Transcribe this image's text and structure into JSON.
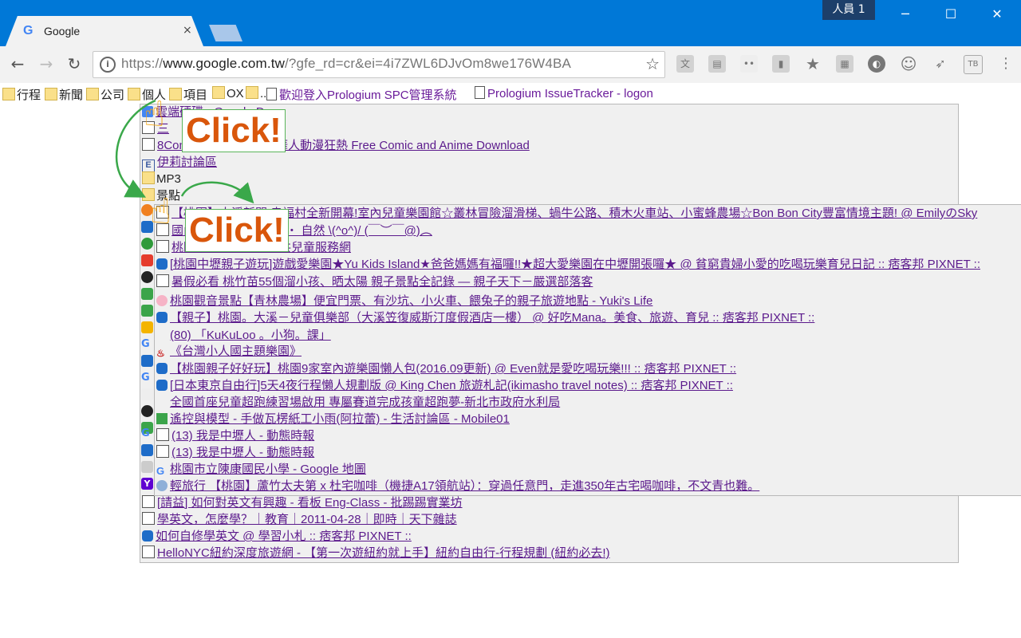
{
  "window": {
    "profile_label": "人員 1",
    "minimize": "─",
    "maximize": "☐",
    "close": "✕"
  },
  "tab": {
    "favicon": "G",
    "title": "Google",
    "close": "×"
  },
  "toolbar": {
    "back": "←",
    "forward": "→",
    "reload": "↻",
    "url_prefix": "https://",
    "url_host": "www.google.com.tw",
    "url_rest": "/?gfe_rd=cr&ei=4i7ZWL6DJvOm8we176W4BA",
    "star": "☆",
    "extensions": [
      "translate-icon",
      "clipboard-icon",
      "dots-icon",
      "bookmark-icon",
      "star-icon",
      "chat-icon",
      "moon-icon",
      "smiley-icon",
      "rocket-icon",
      "tb-icon",
      "menu-icon"
    ]
  },
  "bookmarks": {
    "items": [
      "行程",
      "新聞",
      "公司",
      "個人",
      "項目",
      "OX",
      ".."
    ],
    "link1": "歡迎登入Prologium SPC管理系統",
    "link2": "Prologium IssueTracker - logon"
  },
  "folder_menu": {
    "items": [
      {
        "label": "雲端硬碟 - Google Docs",
        "type": "link"
      },
      {
        "label": "三",
        "type": "link"
      },
      {
        "label": "8Comic 無限動漫 全球華人動漫狂熱 Free Comic and Anime Download",
        "type": "link"
      },
      {
        "label": "伊莉討論區",
        "type": "link"
      },
      {
        "label": "MP3",
        "type": "folder"
      },
      {
        "label": "景點",
        "type": "folder"
      }
    ]
  },
  "lower_items": [
    "[請益] 如何對英文有興趣 - 看板 Eng-Class - 批踢踢實業坊",
    "學英文，怎麼學？｜教育｜2011-04-28｜即時｜天下雜誌",
    "如何自修學英文 @ 學習小札 :: 痞客邦 PIXNET ::",
    "HelloNYC紐約深度旅遊網 - 【第一次遊紐約就上手】紐約自由行-行程規劃 (紐約必去!)"
  ],
  "submenu": {
    "items": [
      "【桃園】大溪新開 幸福村全新開幕!室內兒童樂園館☆叢林冒險溜滑梯、蝸牛公路、積木火車站、小蜜蜂農場☆Bon Bon City豐富情境主題! @ EmilyのSky",
      "國內親子旅遊 小旅行 ‧ 自然 \\(^o^)/ (￣︶￣@)︵",
      "桃園親子館大竹溪公共兒童服務網",
      "[桃園中壢親子遊玩]遊戲愛樂園★Yu Kids Island★爸爸媽媽有福囉!!★超大愛樂園在中壢開張囉★ @ 貧窮貴婦小愛的吃喝玩樂育兒日記 :: 痞客邦 PIXNET ::",
      "暑假必看 桃竹苗55個溜小孩、晒太陽 親子景點全記錄 — 親子天下－嚴選部落客",
      "桃園觀音景點【青林農場】便宜門票、有沙坑、小火車、餵兔子的親子旅遊地點 - Yuki's Life",
      "【親子】桃園。大溪－兒童俱樂部（大溪笠復威斯汀度假酒店一樓） @ 好吃Mana。美食、旅遊、育兒 :: 痞客邦 PIXNET ::",
      "(80) 「KuKuLoo 。小狗。課」",
      "《台灣小人國主題樂園》",
      "【桃園親子好好玩】桃園9家室內遊樂園懶人包(2016.09更新) @ Even就是愛吃喝玩樂!!! :: 痞客邦 PIXNET ::",
      "[日本東京自由行]5天4夜行程懶人規劃版 @ King Chen 旅遊札記(ikimasho travel notes) :: 痞客邦 PIXNET ::",
      "全國首座兒童超跑練習場啟用 專屬賽道完成孩童超跑夢-新北市政府水利局",
      "遙控與模型 - 手做瓦楞紙工小雨(阿拉蕾) - 生活討論區 - Mobile01",
      "(13) 我是中壢人 - 動態時報",
      "(13) 我是中壢人 - 動態時報",
      "桃園市立陳康國民小學 - Google 地圖",
      "輕旅行 【桃園】蘆竹太夫第 x 杜宅咖啡（機捷A17領航站）：穿過任意門，走進350年古宅喝咖啡，不文青也難。"
    ]
  },
  "annotations": {
    "click1": "Click!",
    "click2": "Click!"
  },
  "colors": {
    "titlebar": "#0078d7",
    "link": "#5b1a8c",
    "click_text": "#d9560b",
    "arrow": "#3aa84a"
  }
}
